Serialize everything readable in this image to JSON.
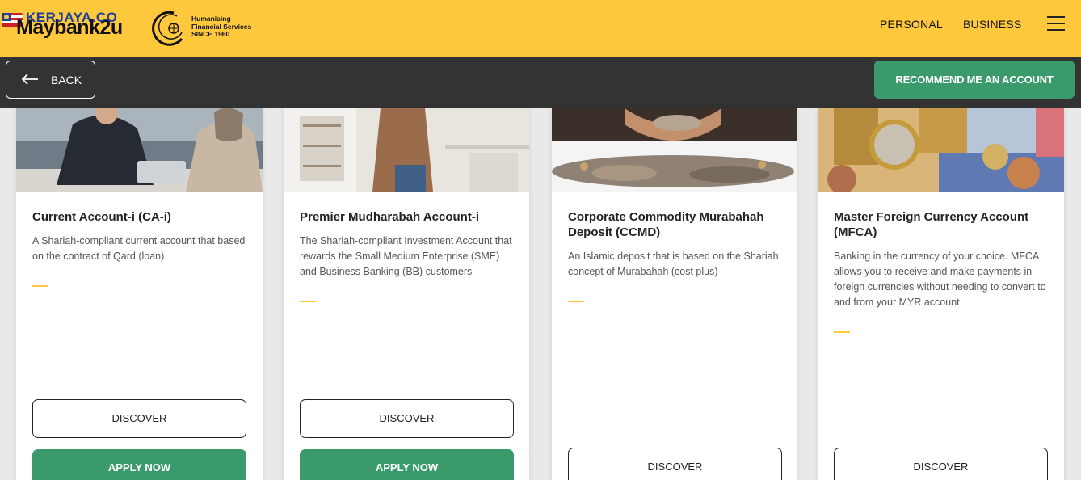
{
  "header": {
    "brand_name": "Maybank2u",
    "brand_overlay": "KERJAYA.CO",
    "tagline": [
      "Humanising",
      "Financial Services",
      "SINCE 1960"
    ],
    "nav": [
      {
        "label": "PERSONAL"
      },
      {
        "label": "BUSINESS"
      }
    ],
    "menu_icon": "hamburger-icon",
    "accent_color": "#ffc83d"
  },
  "toolbar": {
    "back_label": "BACK",
    "recommend_label": "RECOMMEND ME AN ACCOUNT",
    "recommend_color": "#3a9a6b"
  },
  "cards": [
    {
      "title": "Current Account-i (CA-i)",
      "description": "A Shariah-compliant current account that based on the contract of Qard (loan)",
      "image": "business-meeting-photo",
      "discover_label": "DISCOVER",
      "apply_label": "APPLY NOW"
    },
    {
      "title": "Premier Mudharabah Account-i",
      "description": "The Shariah-compliant Investment Account that rewards the Small Medium Enterprise (SME) and Business Banking (BB) customers",
      "image": "office-man-photo",
      "discover_label": "DISCOVER",
      "apply_label": "APPLY NOW"
    },
    {
      "title": "Corporate Commodity Murabahah Deposit (CCMD)",
      "description": "An Islamic deposit that is based on the Shariah concept of Murabahah (cost plus)",
      "image": "hands-coins-photo",
      "discover_label": "DISCOVER"
    },
    {
      "title": "Master Foreign Currency Account (MFCA)",
      "description": "Banking in the currency of your choice. MFCA allows you to receive and make payments in foreign currencies without needing to convert to and from your MYR account",
      "image": "euro-coins-photo",
      "discover_label": "DISCOVER"
    }
  ]
}
